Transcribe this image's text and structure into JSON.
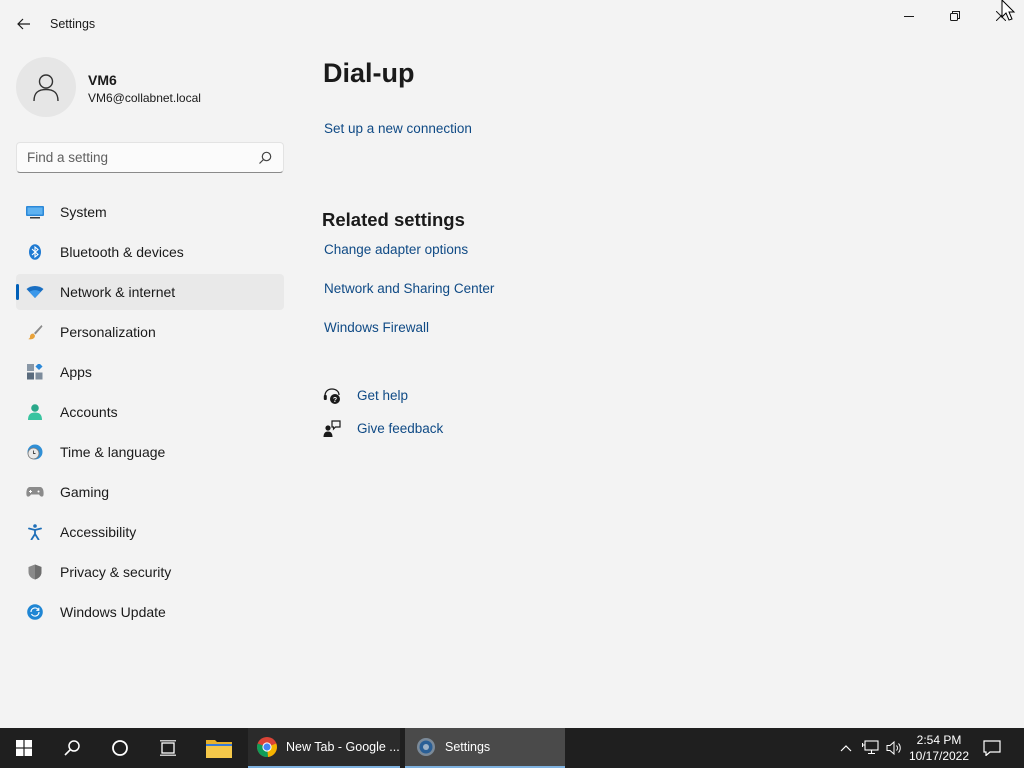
{
  "window": {
    "title": "Settings"
  },
  "profile": {
    "name": "VM6",
    "email": "VM6@collabnet.local"
  },
  "search": {
    "placeholder": "Find a setting"
  },
  "nav": {
    "items": [
      {
        "label": "System",
        "icon": "system-icon"
      },
      {
        "label": "Bluetooth & devices",
        "icon": "bluetooth-icon"
      },
      {
        "label": "Network & internet",
        "icon": "wifi-icon",
        "selected": true
      },
      {
        "label": "Personalization",
        "icon": "brush-icon"
      },
      {
        "label": "Apps",
        "icon": "apps-icon"
      },
      {
        "label": "Accounts",
        "icon": "accounts-icon"
      },
      {
        "label": "Time & language",
        "icon": "clock-globe-icon"
      },
      {
        "label": "Gaming",
        "icon": "gamepad-icon"
      },
      {
        "label": "Accessibility",
        "icon": "accessibility-icon"
      },
      {
        "label": "Privacy & security",
        "icon": "shield-icon"
      },
      {
        "label": "Windows Update",
        "icon": "update-icon"
      }
    ]
  },
  "main": {
    "title": "Dial-up",
    "setup_link": "Set up a new connection",
    "related_title": "Related settings",
    "related_links": [
      "Change adapter options",
      "Network and Sharing Center",
      "Windows Firewall"
    ],
    "help_link": "Get help",
    "feedback_link": "Give feedback"
  },
  "taskbar": {
    "apps": [
      {
        "label": "New Tab - Google ...",
        "icon": "chrome-icon"
      },
      {
        "label": "Settings",
        "icon": "settings-gear-icon"
      }
    ],
    "time": "2:54 PM",
    "date": "10/17/2022"
  },
  "colors": {
    "background": "#f3f3f3",
    "accent": "#005fb8",
    "link": "#0f4a85",
    "taskbar": "#1f1f1f"
  }
}
